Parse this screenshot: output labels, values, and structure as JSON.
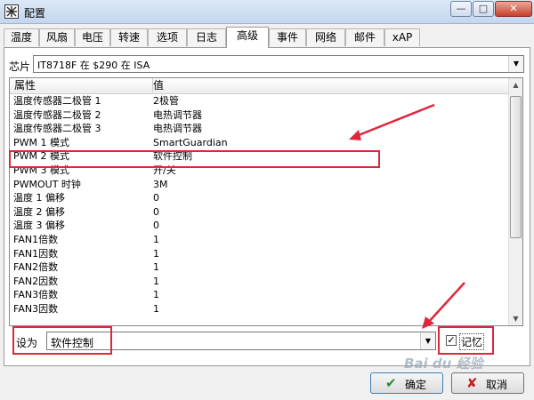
{
  "window": {
    "title": "配置",
    "controls": {
      "minimize": "—",
      "maximize": "□",
      "close": "✕"
    }
  },
  "tabs": [
    {
      "label": "温度",
      "active": false
    },
    {
      "label": "风扇",
      "active": false
    },
    {
      "label": "电压",
      "active": false
    },
    {
      "label": "转速",
      "active": false
    },
    {
      "label": "选项",
      "active": false
    },
    {
      "label": "日志",
      "active": false
    },
    {
      "label": "高级",
      "active": true
    },
    {
      "label": "事件",
      "active": false
    },
    {
      "label": "网络",
      "active": false
    },
    {
      "label": "邮件",
      "active": false
    },
    {
      "label": "xAP",
      "active": false
    }
  ],
  "chip": {
    "label": "芯片",
    "value": "IT8718F 在 $290 在 ISA"
  },
  "list": {
    "headers": {
      "property": "属性",
      "value": "值"
    },
    "rows": [
      {
        "property": "温度传感器二极管 1",
        "value": "2极管"
      },
      {
        "property": "温度传感器二极管 2",
        "value": "电热调节器"
      },
      {
        "property": "温度传感器二极管 3",
        "value": "电热调节器"
      },
      {
        "property": "PWM 1 模式",
        "value": "SmartGuardian"
      },
      {
        "property": "PWM 2 模式",
        "value": "软件控制"
      },
      {
        "property": "PWM 3 模式",
        "value": "开/关"
      },
      {
        "property": "PWMOUT 时钟",
        "value": "3M"
      },
      {
        "property": "温度 1 偏移",
        "value": "0"
      },
      {
        "property": "温度 2 偏移",
        "value": "0"
      },
      {
        "property": "温度 3 偏移",
        "value": "0"
      },
      {
        "property": "FAN1倍数",
        "value": "1"
      },
      {
        "property": "FAN1因数",
        "value": "1"
      },
      {
        "property": "FAN2倍数",
        "value": "1"
      },
      {
        "property": "FAN2因数",
        "value": "1"
      },
      {
        "property": "FAN3倍数",
        "value": "1"
      },
      {
        "property": "FAN3因数",
        "value": "1"
      }
    ]
  },
  "set_as": {
    "label": "设为",
    "value": "软件控制"
  },
  "remember": {
    "label": "记忆",
    "checked": true,
    "mark": "✓"
  },
  "buttons": {
    "ok": {
      "label": "确定",
      "icon": "✔"
    },
    "cancel": {
      "label": "取消",
      "icon": "✘"
    }
  },
  "watermark": "Bai du 经验",
  "colors": {
    "highlight": "#e0263b",
    "ok_icon": "#2f8a2f",
    "cancel_icon": "#c02020"
  }
}
